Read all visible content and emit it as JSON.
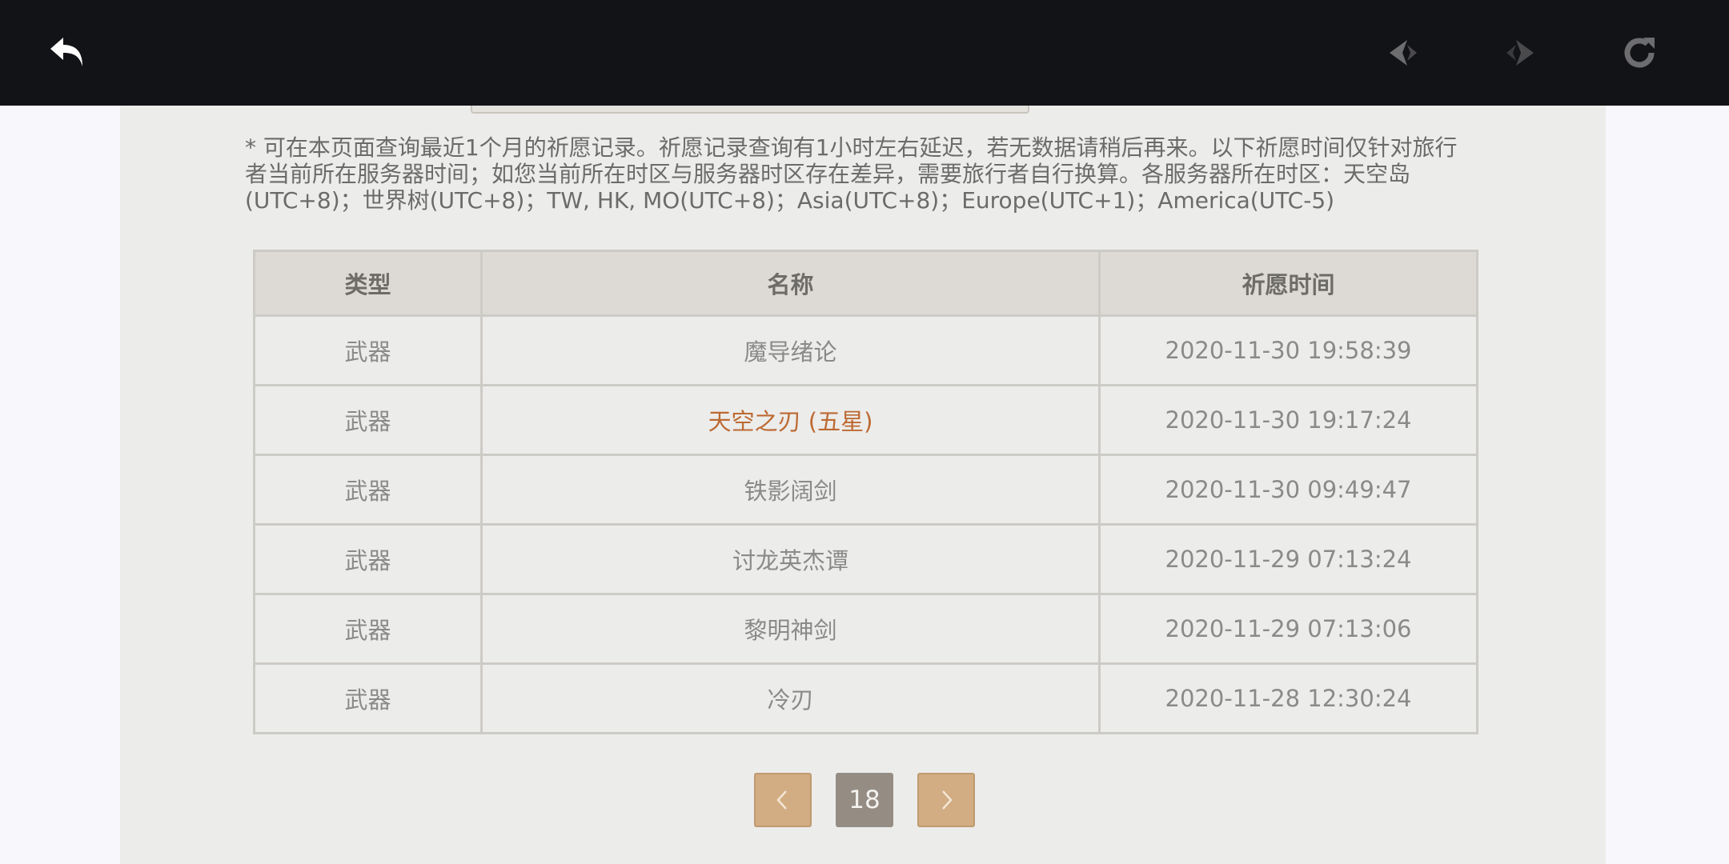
{
  "toolbar": {
    "back_icon": "back-arrow-icon",
    "prev_icon": "navigate-back-icon",
    "next_icon": "navigate-forward-icon",
    "reload_icon": "reload-icon"
  },
  "notice": "* 可在本页面查询最近1个月的祈愿记录。祈愿记录查询有1小时左右延迟，若无数据请稍后再来。以下祈愿时间仅针对旅行者当前所在服务器时间；如您当前所在时区与服务器时区存在差异，需要旅行者自行换算。各服务器所在时区：天空岛(UTC+8)；世界树(UTC+8)；TW, HK, MO(UTC+8)；Asia(UTC+8)；Europe(UTC+1)；America(UTC-5)",
  "table": {
    "headers": [
      "类型",
      "名称",
      "祈愿时间"
    ],
    "rows": [
      {
        "type": "武器",
        "name": "魔导绪论",
        "time": "2020-11-30 19:58:39"
      },
      {
        "type": "武器",
        "name": "天空之刃 (五星)",
        "time": "2020-11-30 19:17:24"
      },
      {
        "type": "武器",
        "name": "铁影阔剑",
        "time": "2020-11-30 09:49:47"
      },
      {
        "type": "武器",
        "name": "讨龙英杰谭",
        "time": "2020-11-29 07:13:24"
      },
      {
        "type": "武器",
        "name": "黎明神剑",
        "time": "2020-11-29 07:13:06"
      },
      {
        "type": "武器",
        "name": "冷刃",
        "time": "2020-11-28 12:30:24"
      }
    ]
  },
  "pagination": {
    "prev_label": "‹",
    "current_page": "18",
    "next_label": "›"
  },
  "colors": {
    "five_star": "#bd6932",
    "pager_button": "#d2ac82",
    "pager_current": "#958d84"
  }
}
